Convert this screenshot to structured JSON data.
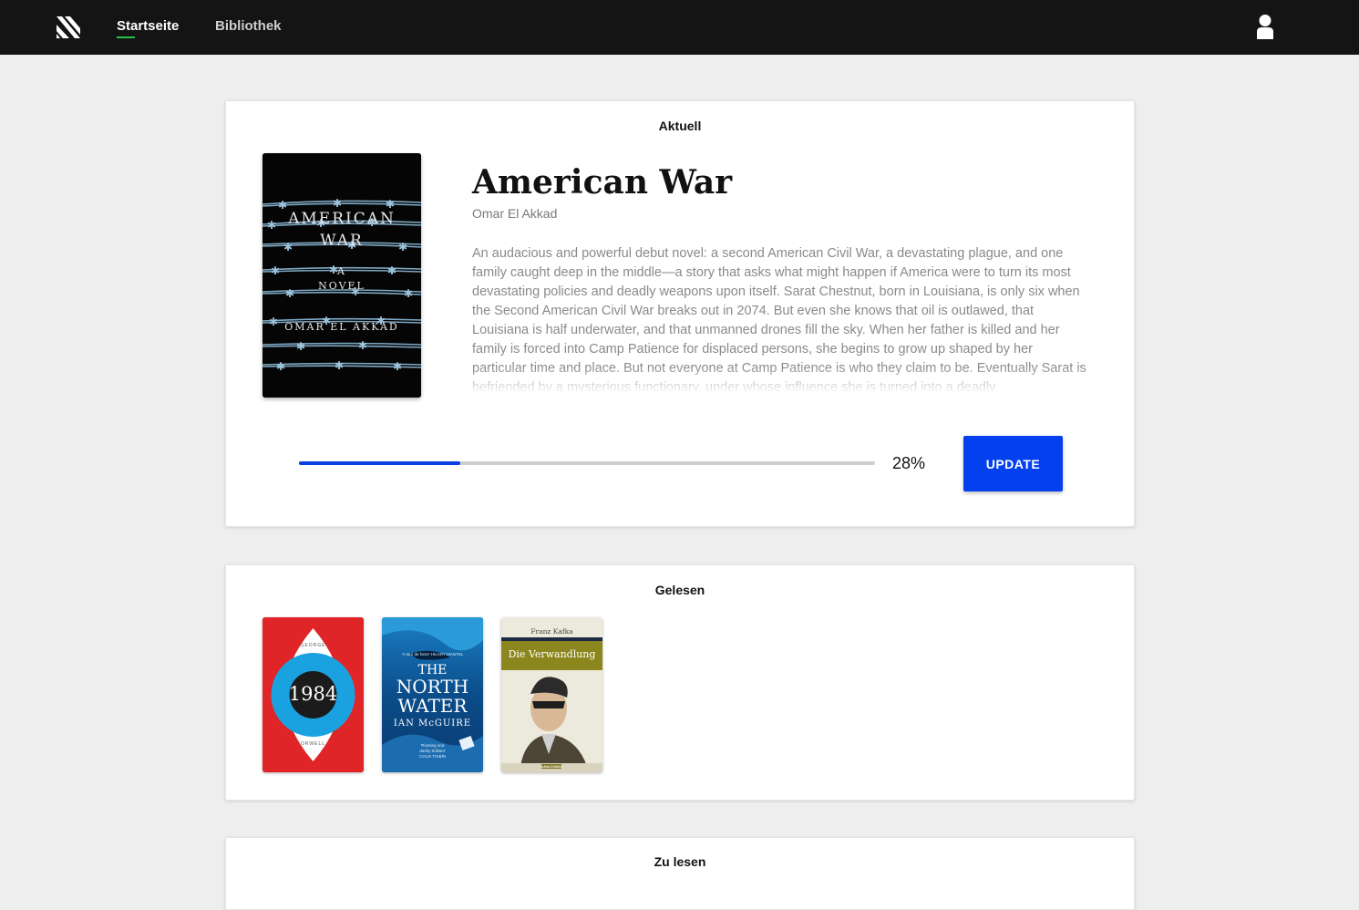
{
  "nav": {
    "items": [
      {
        "label": "Startseite",
        "active": true
      },
      {
        "label": "Bibliothek",
        "active": false
      }
    ],
    "accent": "#24c24a"
  },
  "current": {
    "section_title": "Aktuell",
    "book": {
      "title": "American War",
      "author": "Omar El Akkad",
      "description": "An audacious and powerful debut novel: a second American Civil War, a devastating plague, and one family caught deep in the middle—a story that asks what might happen if America were to turn its most devastating policies and deadly weapons upon itself. Sarat Chestnut, born in Louisiana, is only six when the Second American Civil War breaks out in 2074. But even she knows that oil is outlawed, that Louisiana is half underwater, and that unmanned drones fill the sky. When her father is killed and her family is forced into Camp Patience for displaced persons, she begins to grow up shaped by her particular time and place. But not everyone at Camp Patience is who they claim to be. Eventually Sarat is befriended by a mysterious functionary, under whose influence she is turned into a deadly",
      "cover": {
        "line1": "AMERICAN",
        "line2": "WAR",
        "line3": "A",
        "line4": "NOVEL",
        "line5": "OMAR EL AKKAD"
      }
    },
    "progress_fraction": 0.28,
    "progress_label": "28%",
    "update_label": "UPDATE",
    "accent": "#0540ef"
  },
  "read": {
    "section_title": "Gelesen",
    "books": [
      {
        "cover_top": "GEORGE",
        "cover_title": "1984",
        "cover_bottom": "ORWELL"
      },
      {
        "cover_quote": "'A tour de force' HILARY MANTEL",
        "cover_title1": "THE",
        "cover_title2": "NORTH",
        "cover_title3": "WATER",
        "cover_author": "IAN McGUIRE",
        "cover_blurb1": "'Riveting and",
        "cover_blurb2": "darkly brilliant'",
        "cover_blurb3": "COLM TÓIBÍN"
      },
      {
        "cover_author": "Franz Kafka",
        "cover_title": "Die Verwandlung",
        "cover_publisher": "ANACONDA"
      }
    ]
  },
  "to_read": {
    "section_title": "Zu lesen"
  }
}
